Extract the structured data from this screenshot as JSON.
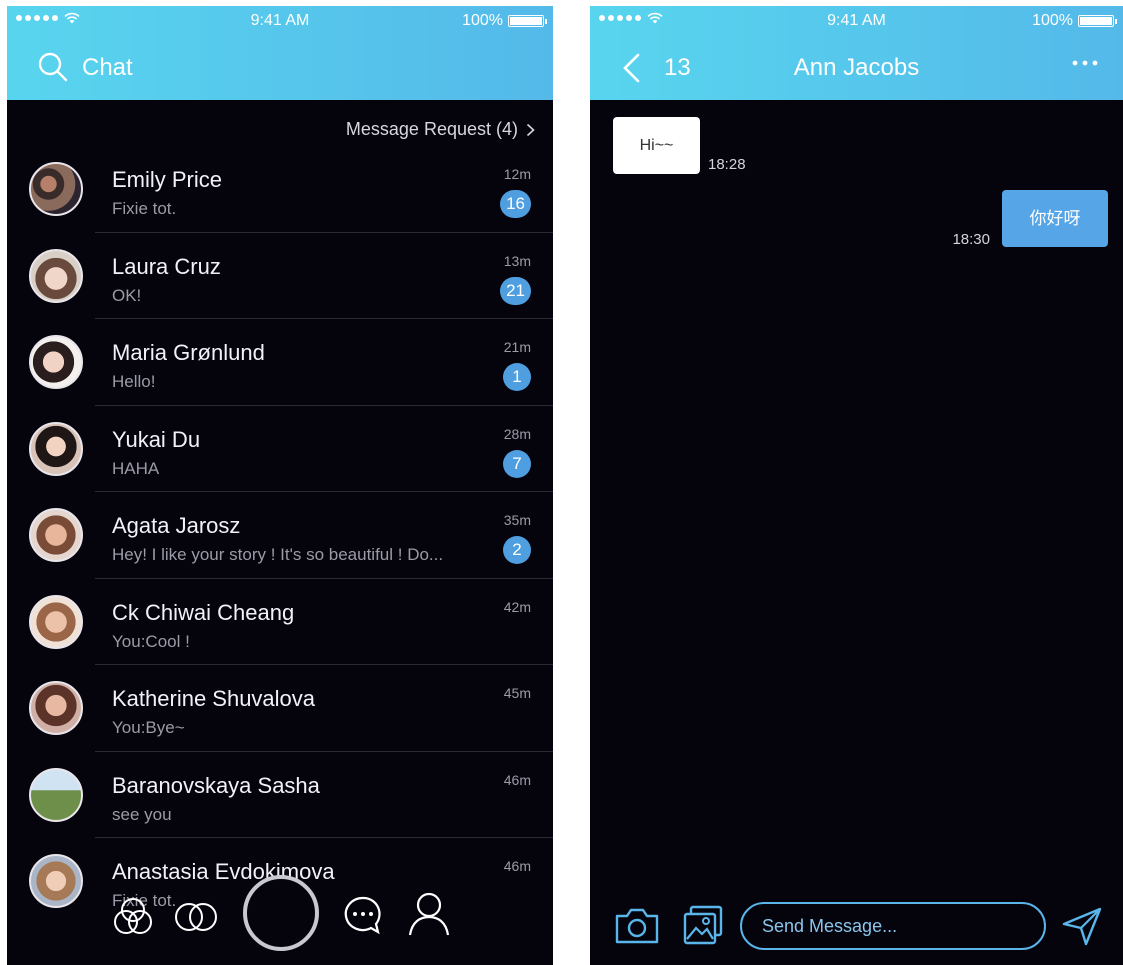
{
  "status_bar": {
    "time": "9:41 AM",
    "battery": "100%"
  },
  "chat_list": {
    "title": "Chat",
    "request_label": "Message Request (4)",
    "conversations": [
      {
        "name": "Emily Price",
        "preview": "Fixie tot.",
        "time": "12m",
        "unread": "16"
      },
      {
        "name": "Laura Cruz",
        "preview": "OK!",
        "time": "13m",
        "unread": "21"
      },
      {
        "name": "Maria Grønlund",
        "preview": "Hello!",
        "time": "21m",
        "unread": "1"
      },
      {
        "name": "Yukai Du",
        "preview": "HAHA",
        "time": "28m",
        "unread": "7"
      },
      {
        "name": "Agata Jarosz",
        "preview": "Hey! I like your story ! It's so beautiful ! Do...",
        "time": "35m",
        "unread": "2"
      },
      {
        "name": "Ck Chiwai Cheang",
        "preview": "You:Cool !",
        "time": "42m",
        "unread": ""
      },
      {
        "name": "Katherine Shuvalova",
        "preview": "You:Bye~",
        "time": "45m",
        "unread": ""
      },
      {
        "name": "Baranovskaya Sasha",
        "preview": "see you",
        "time": "46m",
        "unread": ""
      },
      {
        "name": "Anastasia Evdokimova",
        "preview": "Fixie tot.",
        "time": "46m",
        "unread": ""
      }
    ],
    "tabs": [
      {
        "icon": "three-circles-icon"
      },
      {
        "icon": "two-circles-icon"
      },
      {
        "icon": "camera-ring-icon"
      },
      {
        "icon": "chat-bubble-icon"
      },
      {
        "icon": "profile-icon"
      }
    ]
  },
  "conversation": {
    "back_count": "13",
    "title": "Ann Jacobs",
    "messages": [
      {
        "direction": "incoming",
        "text": "Hi~~",
        "time": "18:28"
      },
      {
        "direction": "outgoing",
        "text": "你好呀",
        "time": "18:30"
      }
    ],
    "input_placeholder": "Send Message...",
    "colors": {
      "accent": "#54b9e9",
      "background": "#05040d",
      "outgoing_bubble": "#56a5e6"
    }
  }
}
